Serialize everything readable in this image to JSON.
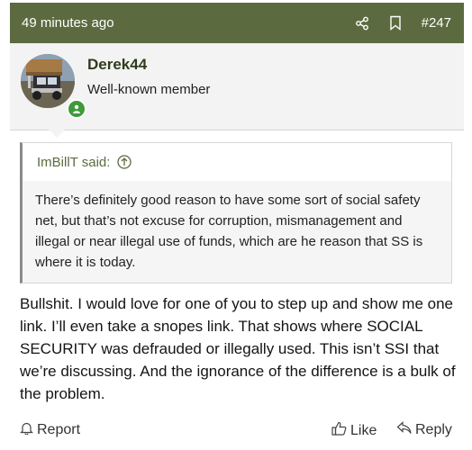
{
  "post": {
    "time": "49 minutes ago",
    "number": "#247"
  },
  "user": {
    "name": "Derek44",
    "title": "Well-known member"
  },
  "quote": {
    "author": "ImBillT said:",
    "text": "There’s definitely good reason to have some sort of social safety net, but that’s not excuse for corruption, mismanagement and illegal or near illegal use of funds, which are he reason that SS is where it is today."
  },
  "message": "Bullshit. I would love for one of you to step up and show me one link. I’ll even take a snopes link. That shows where SOCIAL SECURITY was defrauded or illegally used. This isn’t SSI that we’re discussing. And the ignorance of the difference is a bulk of the problem.",
  "actions": {
    "report": "Report",
    "like": "Like",
    "reply": "Reply"
  },
  "icons": [
    "share-icon",
    "bookmark-icon",
    "online-status-icon",
    "arrow-up-circle-icon",
    "bell-icon",
    "thumbs-up-icon",
    "reply-arrow-icon"
  ],
  "colors": {
    "header_bg": "#5b6b3f",
    "username": "#2f3c1d",
    "online": "#3f9a3a"
  }
}
